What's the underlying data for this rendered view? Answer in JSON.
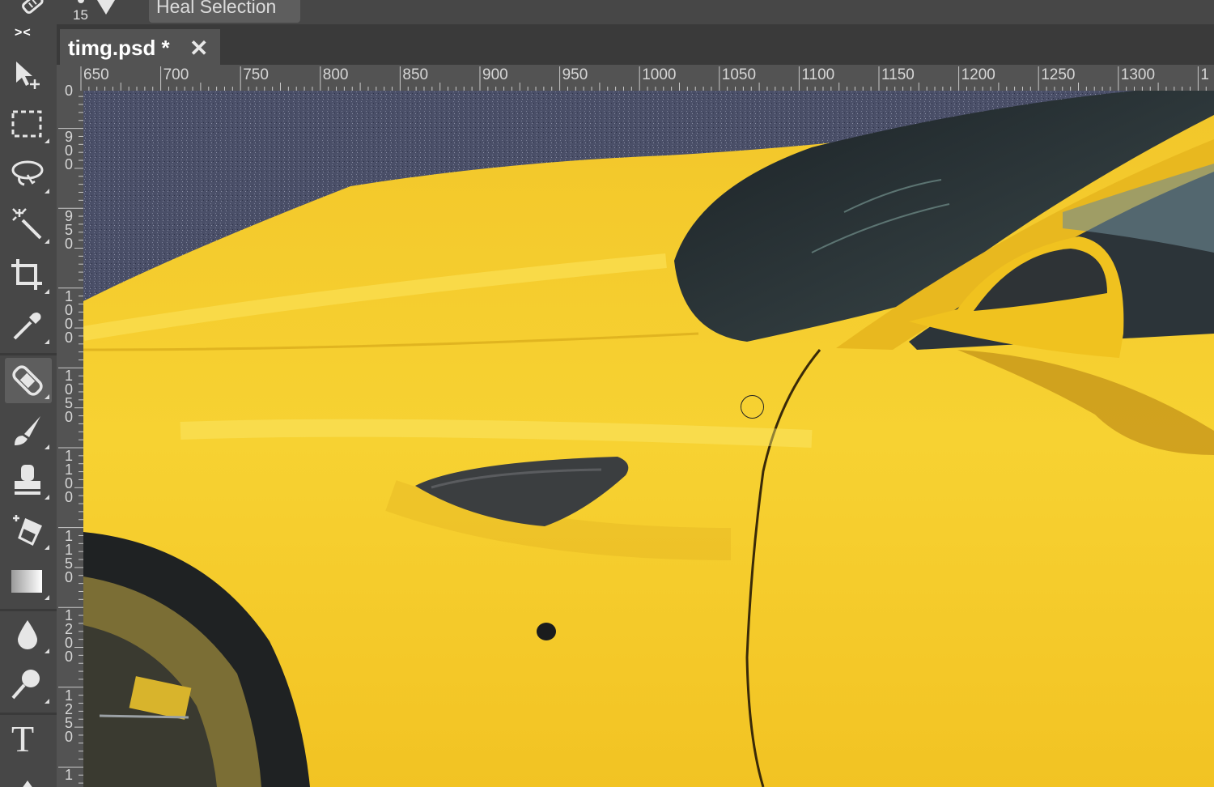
{
  "options_bar": {
    "brush_size": "15",
    "heal_button": "Heal Selection"
  },
  "toolbar": {
    "collapse_label": "><",
    "tools": [
      {
        "name": "move-tool",
        "icon": "move-icon"
      },
      {
        "name": "marquee-tool",
        "icon": "marquee-icon"
      },
      {
        "name": "lasso-tool",
        "icon": "lasso-icon"
      },
      {
        "name": "magic-wand-tool",
        "icon": "magic-wand-icon"
      },
      {
        "name": "crop-tool",
        "icon": "crop-icon"
      },
      {
        "name": "eyedropper-tool",
        "icon": "eyedropper-icon"
      },
      {
        "name": "healing-brush-tool",
        "icon": "bandage-icon",
        "active": true
      },
      {
        "name": "brush-tool",
        "icon": "brush-icon"
      },
      {
        "name": "clone-stamp-tool",
        "icon": "stamp-icon"
      },
      {
        "name": "eraser-tool",
        "icon": "eraser-icon"
      },
      {
        "name": "gradient-tool",
        "icon": "gradient-icon"
      },
      {
        "name": "blur-tool",
        "icon": "drop-icon"
      },
      {
        "name": "dodge-tool",
        "icon": "dodge-icon"
      },
      {
        "name": "text-tool",
        "icon": "text-icon"
      }
    ],
    "text_tool_label": "T"
  },
  "document_tab": {
    "title": "timg.psd *",
    "close": "✕"
  },
  "rulers": {
    "horizontal": [
      "650",
      "700",
      "750",
      "800",
      "850",
      "900",
      "950",
      "1000",
      "1050",
      "1100",
      "1150",
      "1200",
      "1250",
      "1300",
      "1"
    ],
    "vertical": [
      "0",
      "900",
      "950",
      "1000",
      "1050",
      "1100",
      "1150",
      "1200",
      "1250",
      "1"
    ]
  },
  "colors": {
    "panel": "#474747",
    "ruler": "#535353",
    "car_yellow": "#f5cb2a",
    "asphalt": "#4a4f68"
  }
}
